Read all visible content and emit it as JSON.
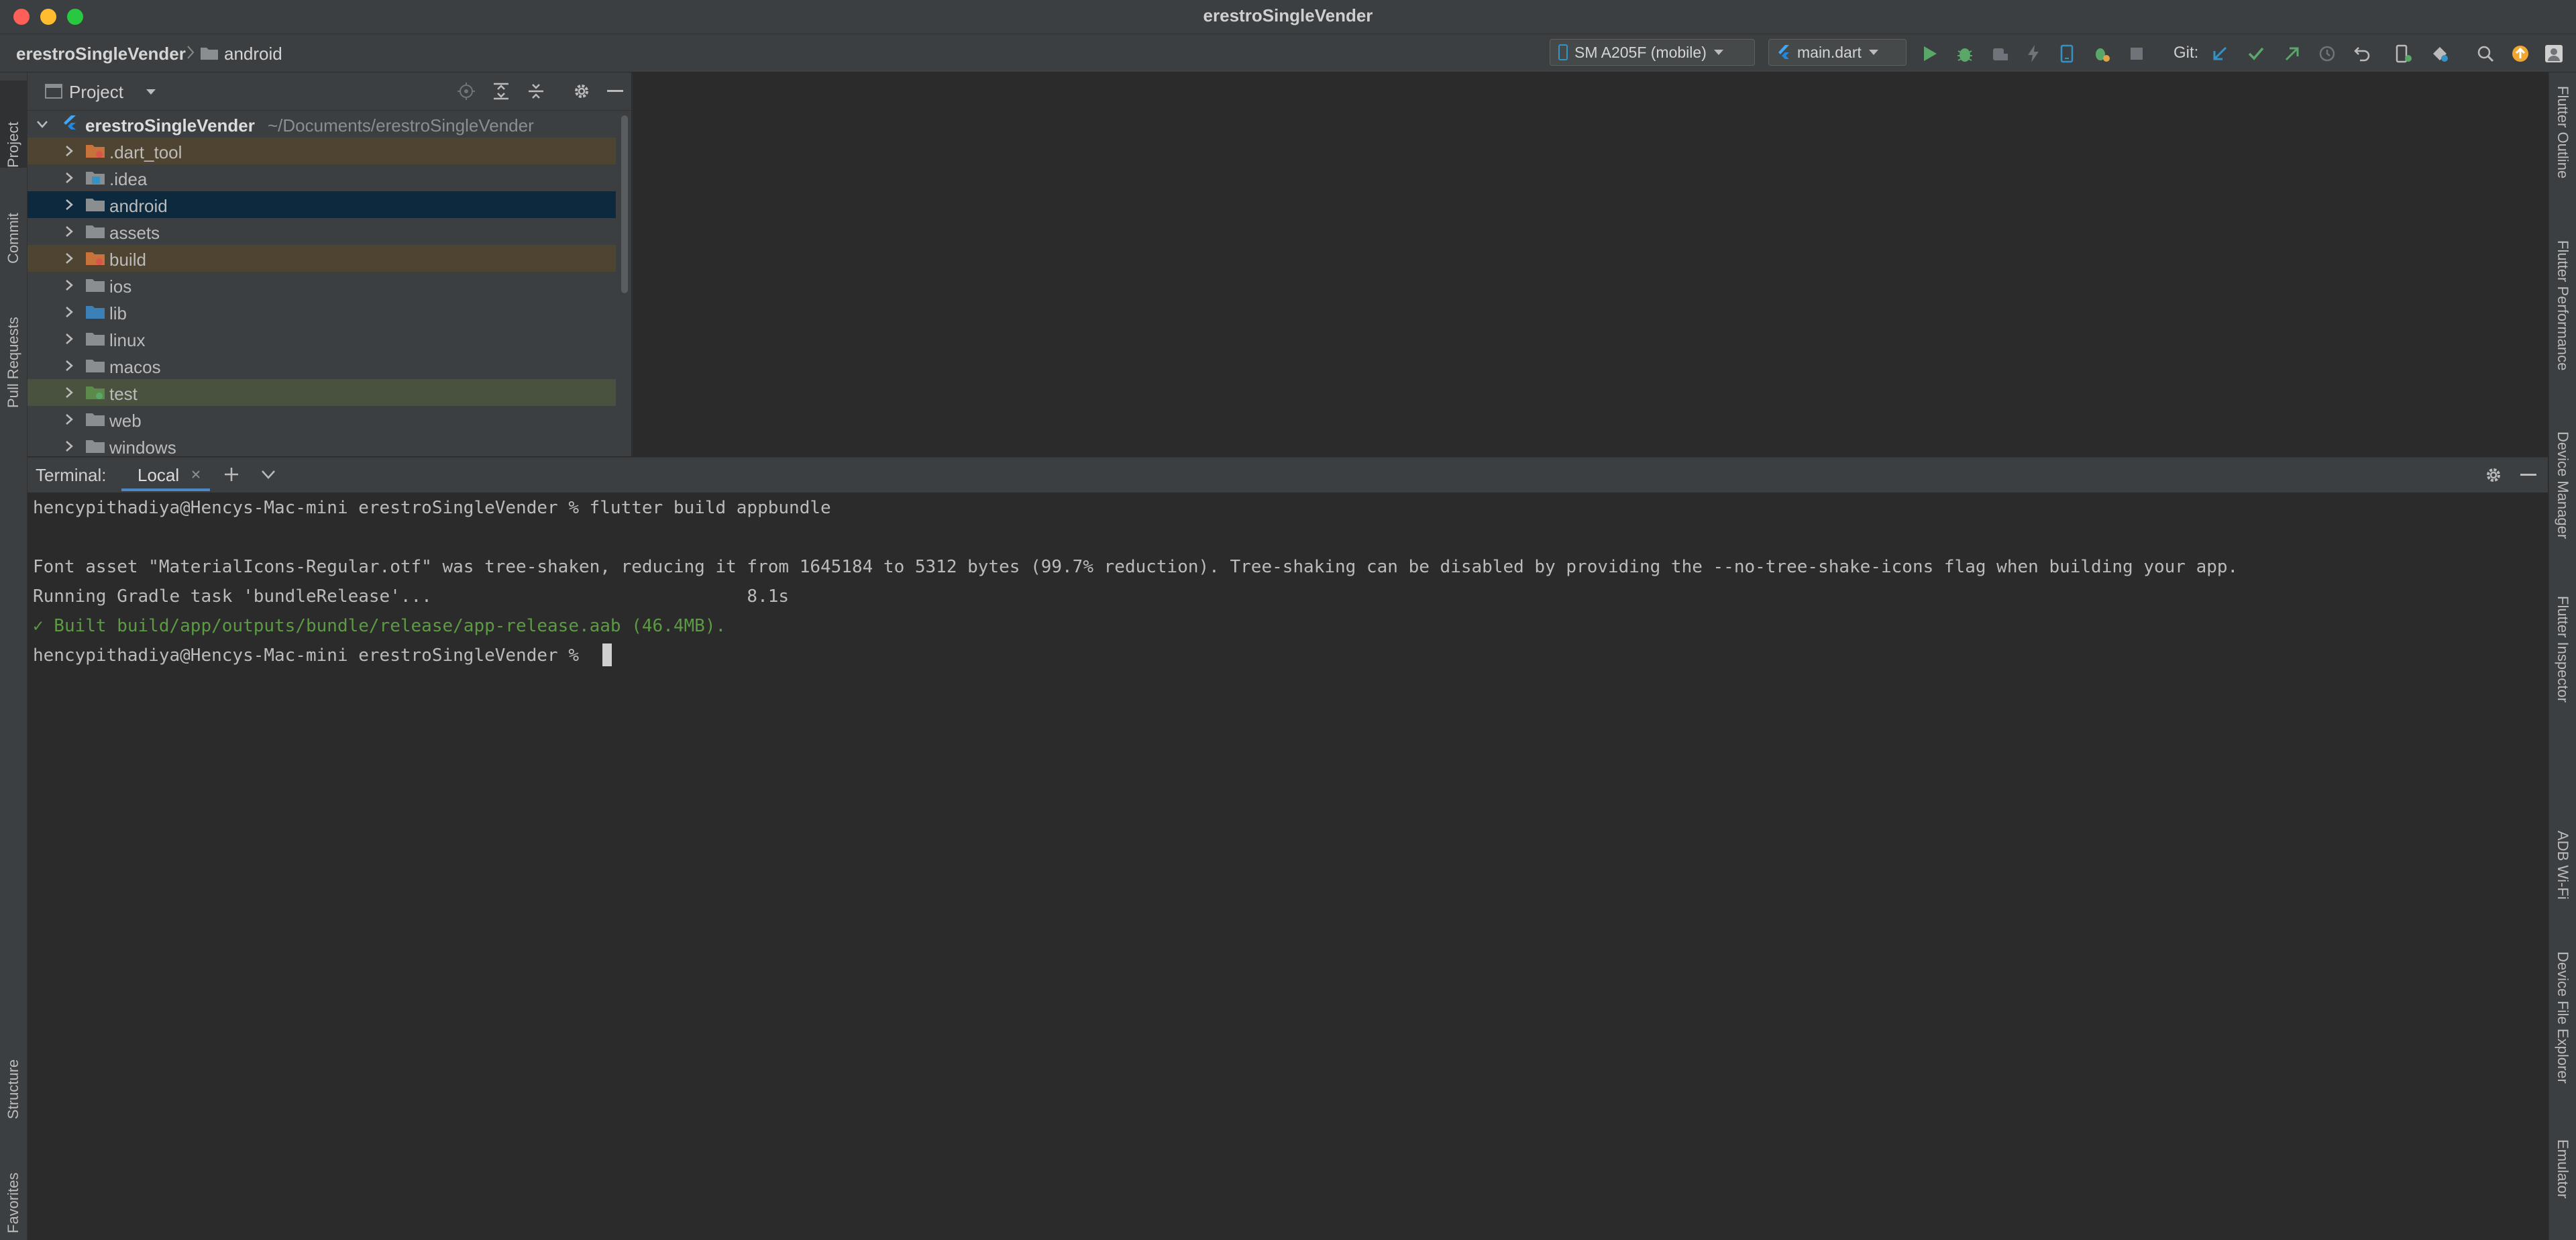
{
  "window": {
    "title": "erestroSingleVender"
  },
  "nav": {
    "breadcrumb_project": "erestroSingleVender",
    "breadcrumb_folder": "android",
    "device": "SM A205F (mobile)",
    "run_config": "main.dart",
    "git_label": "Git:"
  },
  "left_tabs": {
    "project": "Project",
    "commit": "Commit",
    "pull_requests": "Pull Requests",
    "structure": "Structure",
    "favorites": "Favorites"
  },
  "right_tabs": {
    "flutter_outline": "Flutter Outline",
    "flutter_performance": "Flutter Performance",
    "device_manager": "Device Manager",
    "flutter_inspector": "Flutter Inspector",
    "adb_wifi": "ADB Wi-Fi",
    "device_file_explorer": "Device File Explorer",
    "emulator": "Emulator"
  },
  "project": {
    "header": "Project",
    "root_name": "erestroSingleVender",
    "root_path": "~/Documents/erestroSingleVender",
    "items": [
      {
        "label": ".dart_tool",
        "kind": "excluded"
      },
      {
        "label": ".idea",
        "kind": "config"
      },
      {
        "label": "android",
        "kind": "selected"
      },
      {
        "label": "assets",
        "kind": "plain"
      },
      {
        "label": "build",
        "kind": "excluded"
      },
      {
        "label": "ios",
        "kind": "plain"
      },
      {
        "label": "lib",
        "kind": "source"
      },
      {
        "label": "linux",
        "kind": "plain"
      },
      {
        "label": "macos",
        "kind": "plain"
      },
      {
        "label": "test",
        "kind": "test"
      },
      {
        "label": "web",
        "kind": "plain"
      },
      {
        "label": "windows",
        "kind": "plain"
      }
    ]
  },
  "terminal": {
    "label": "Terminal:",
    "tab": "Local",
    "lines": [
      "hencypithadiya@Hencys-Mac-mini erestroSingleVender % flutter build appbundle",
      "",
      "Font asset \"MaterialIcons-Regular.otf\" was tree-shaken, reducing it from 1645184 to 5312 bytes (99.7% reduction). Tree-shaking can be disabled by providing the --no-tree-shake-icons flag when building your app.",
      "Running Gradle task 'bundleRelease'...                              8.1s",
      "✓ Built build/app/outputs/bundle/release/app-release.aab (46.4MB).",
      "hencypithadiya@Hencys-Mac-mini erestroSingleVender % "
    ]
  },
  "colors": {
    "bg": "#2b2b2b",
    "panel": "#3c3f41",
    "selected_row": "#0d293e",
    "excluded_row": "#4f4432",
    "test_row": "#49523f",
    "success": "#5c9a43",
    "run_green": "#59a869"
  }
}
